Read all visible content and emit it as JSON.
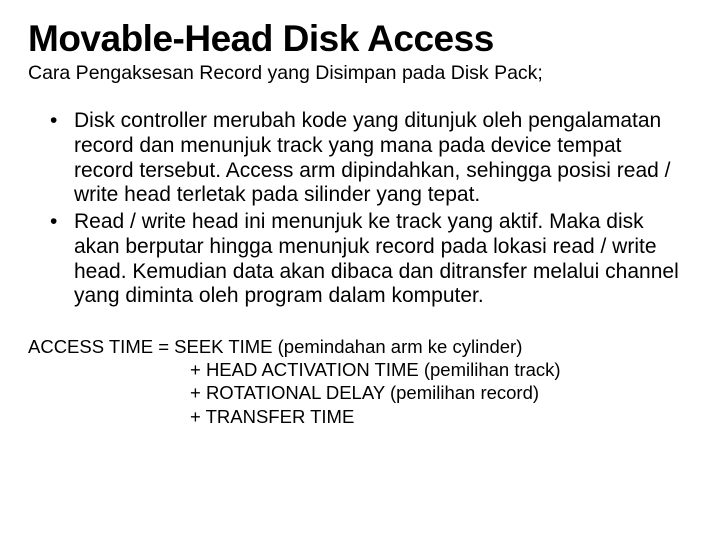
{
  "title": "Movable-Head Disk Access",
  "subtitle": "Cara Pengaksesan Record yang Disimpan pada Disk Pack;",
  "bullets": [
    "Disk controller merubah kode yang ditunjuk oleh pengalamatan record dan menunjuk track yang mana pada device tempat record tersebut. Access arm dipindahkan, sehingga posisi read / write head terletak pada silinder yang tepat.",
    "Read / write head ini menunjuk ke track yang aktif. Maka disk akan berputar hingga menunjuk record pada lokasi read / write head. Kemudian data akan dibaca dan ditransfer melalui channel yang diminta oleh program dalam komputer."
  ],
  "formula": {
    "line1": "ACCESS TIME  =  SEEK TIME (pemindahan arm ke cylinder)",
    "line2": "+  HEAD ACTIVATION TIME (pemilihan track)",
    "line3": "+  ROTATIONAL DELAY (pemilihan record)",
    "line4": "+  TRANSFER TIME"
  }
}
